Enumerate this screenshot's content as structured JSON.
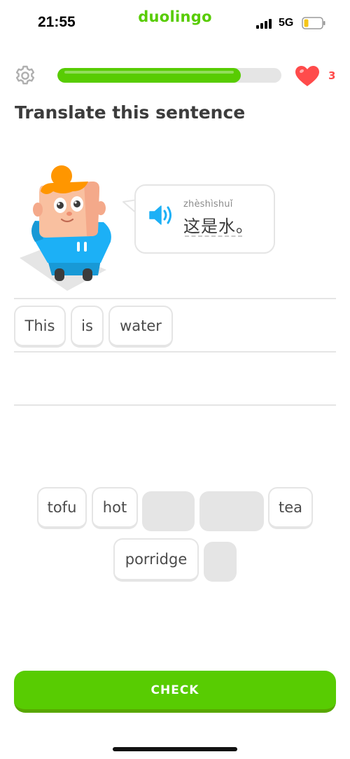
{
  "status_bar": {
    "time": "21:55",
    "brand": "duolingo",
    "network": "5G"
  },
  "lesson": {
    "progress": 0.82,
    "hearts": "3",
    "instruction": "Translate this sentence"
  },
  "prompt": {
    "pinyin": "zhèshìshuǐ",
    "sentence": "这是水。"
  },
  "answer_tiles": [
    {
      "label": "This"
    },
    {
      "label": "is"
    },
    {
      "label": "water"
    }
  ],
  "word_bank": [
    {
      "label": "tofu",
      "used": false
    },
    {
      "label": "hot",
      "used": false
    },
    {
      "label": "",
      "used": true
    },
    {
      "label": "",
      "used": true
    },
    {
      "label": "tea",
      "used": false
    },
    {
      "label": "porridge",
      "used": false
    },
    {
      "label": "",
      "used": true
    }
  ],
  "check_button": {
    "label": "CHECK"
  },
  "colors": {
    "accent_green": "#58cc02",
    "heart_red": "#ff4b4b",
    "speaker_blue": "#1cb0f6"
  }
}
